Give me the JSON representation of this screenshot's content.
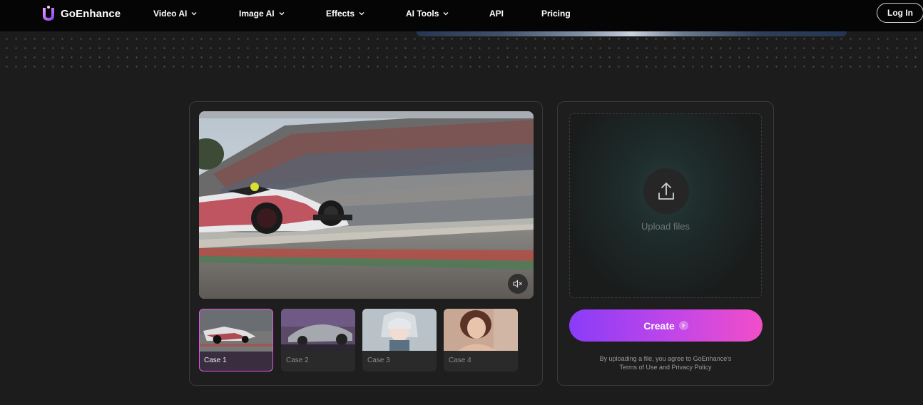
{
  "nav": {
    "brand": "GoEnhance",
    "items": [
      {
        "label": "Video AI",
        "dropdown": true
      },
      {
        "label": "Image AI",
        "dropdown": true
      },
      {
        "label": "Effects",
        "dropdown": true
      },
      {
        "label": "AI Tools",
        "dropdown": true
      },
      {
        "label": "API",
        "dropdown": false
      },
      {
        "label": "Pricing",
        "dropdown": false
      }
    ],
    "login_label": "Log In"
  },
  "cases": [
    {
      "label": "Case 1",
      "active": true
    },
    {
      "label": "Case 2",
      "active": false
    },
    {
      "label": "Case 3",
      "active": false
    },
    {
      "label": "Case 4",
      "active": false
    }
  ],
  "upload": {
    "label": "Upload files"
  },
  "create": {
    "label": "Create"
  },
  "terms": {
    "line1": "By uploading a file, you agree to GoEnhance's",
    "line2": "Terms of Use and Privacy Policy"
  },
  "colors": {
    "accent_start": "#8a3cf8",
    "accent_end": "#f24ec8",
    "active_case_border": "#e255ea",
    "background": "#1c1c1c"
  }
}
